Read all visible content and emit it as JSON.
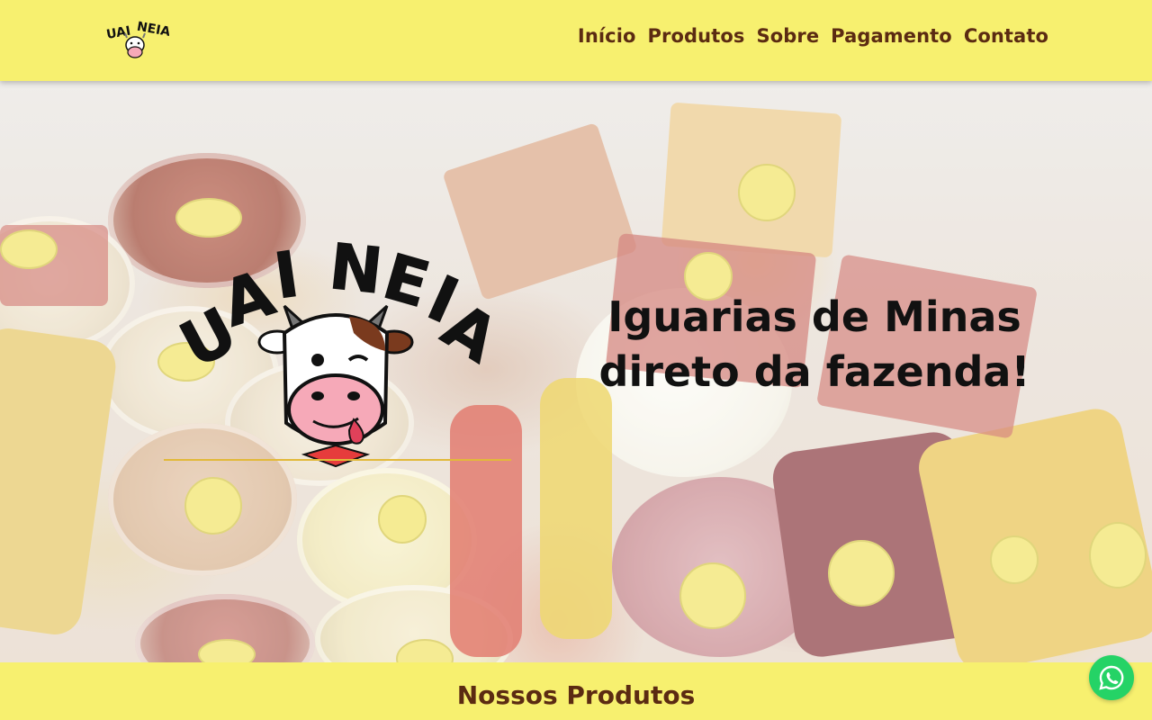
{
  "brand": {
    "logo_text": "UAI NEIA",
    "logo_icon": "cow-mascot-icon"
  },
  "nav": {
    "items": [
      {
        "label": "Início"
      },
      {
        "label": "Produtos"
      },
      {
        "label": "Sobre"
      },
      {
        "label": "Pagamento"
      },
      {
        "label": "Contato"
      }
    ]
  },
  "hero": {
    "logo_text": "UAI NEIA",
    "title_line1": "Iguarias de Minas",
    "title_line2": "direto da fazenda!"
  },
  "products_section": {
    "title": "Nossos Produtos"
  },
  "floating": {
    "whatsapp_icon": "whatsapp-icon"
  },
  "colors": {
    "header_bg": "#f7f06f",
    "nav_text": "#5b2b12",
    "accent_gold": "#e2b93a",
    "whatsapp_green": "#25d366"
  }
}
